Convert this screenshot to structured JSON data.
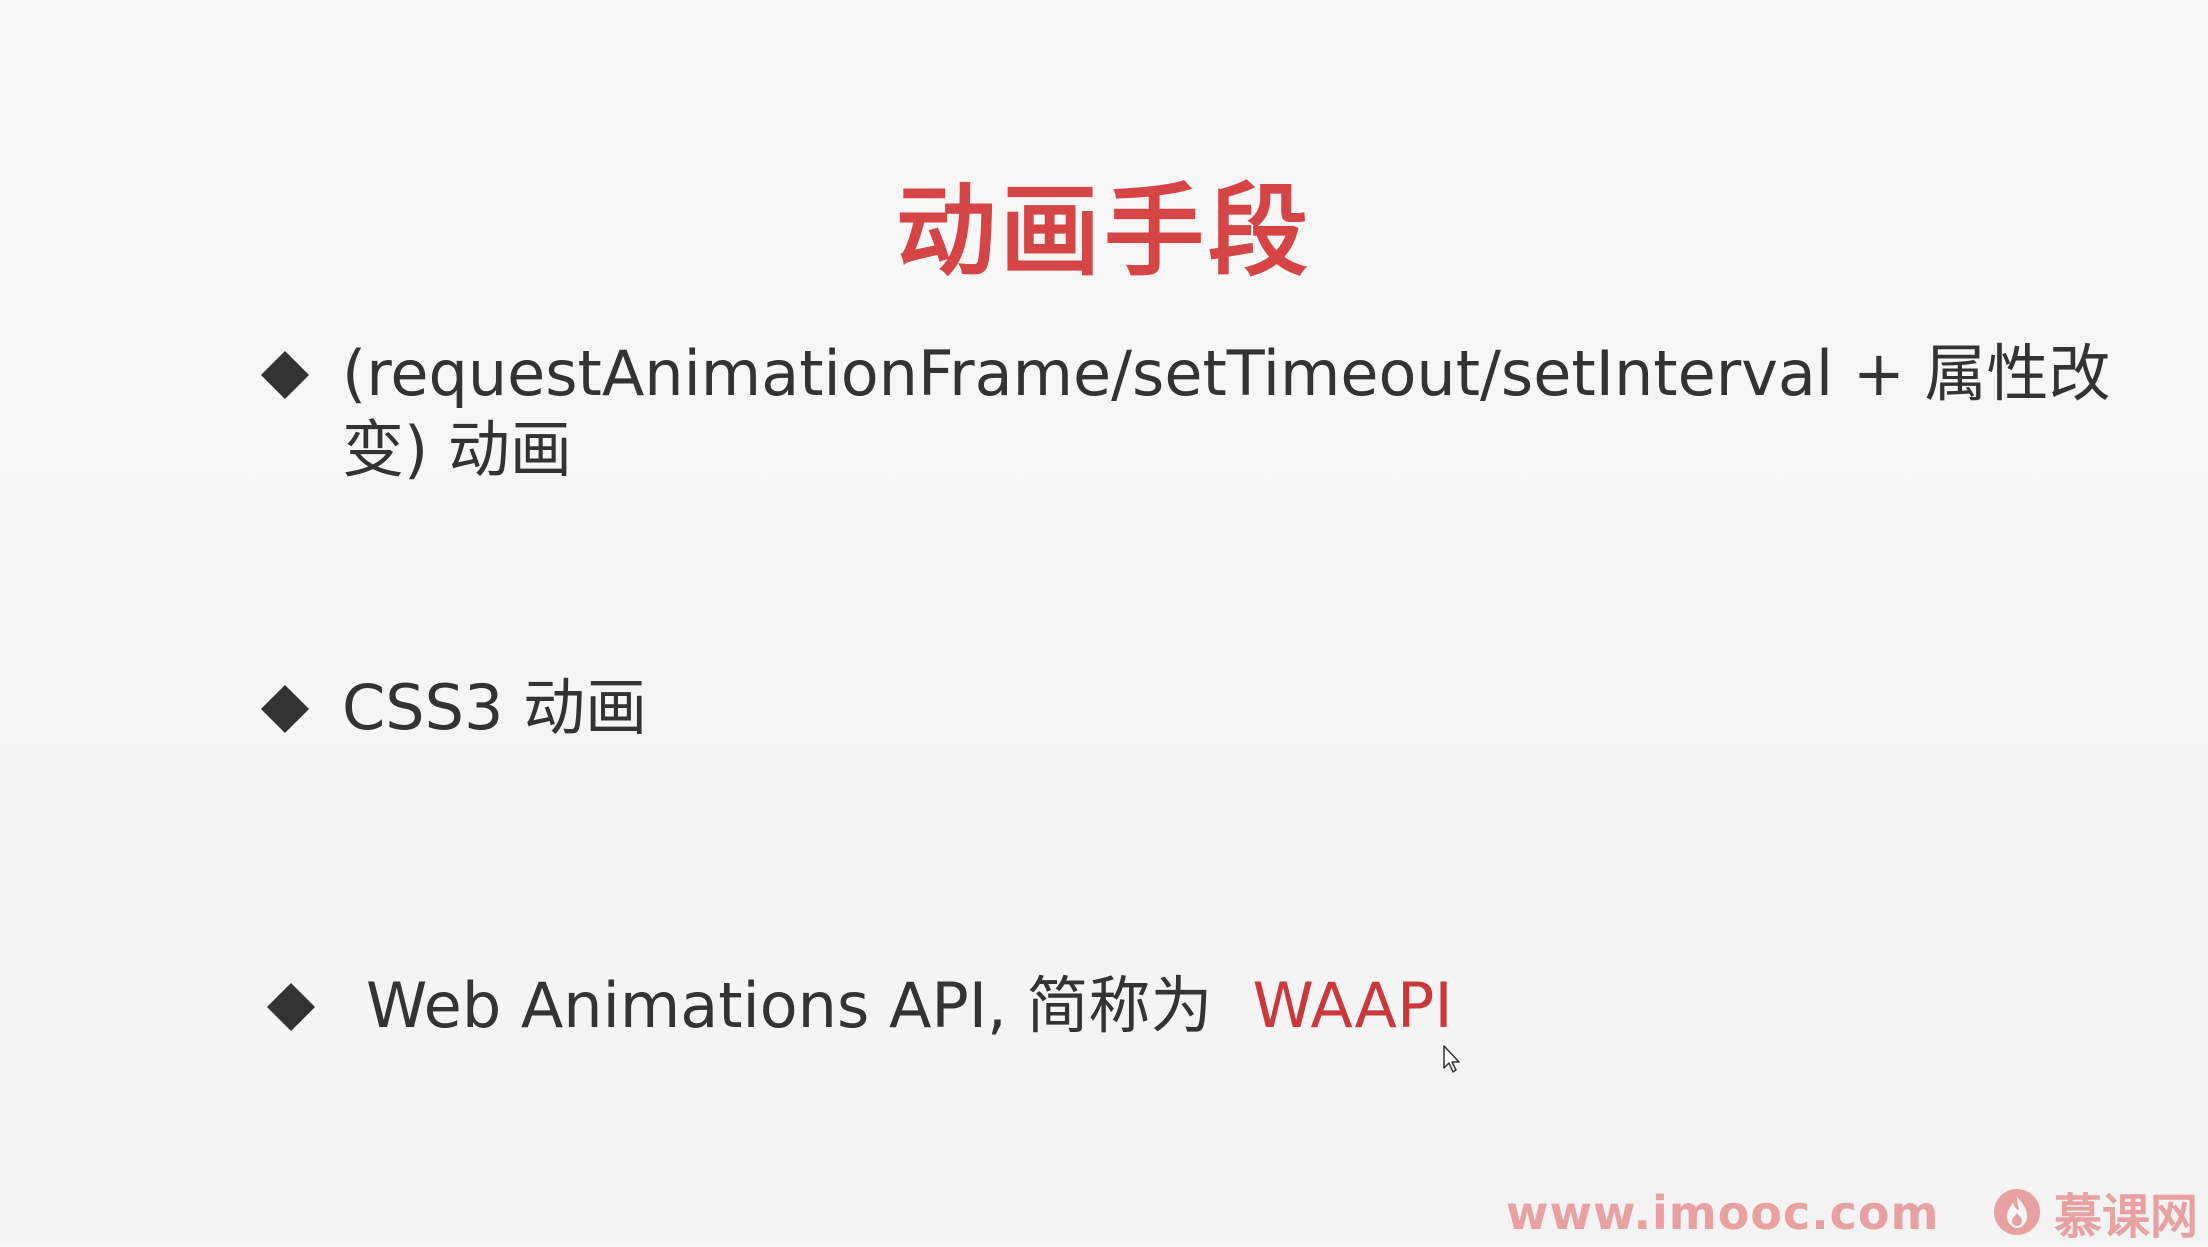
{
  "slide": {
    "title": "动画手段",
    "bullets": [
      {
        "text": "(requestAnimationFrame/setTimeout/setInterval + 属性改变) 动画"
      },
      {
        "text": "CSS3 动画"
      },
      {
        "text": "Web Animations API, 简称为",
        "accent": "WAAPI"
      }
    ]
  },
  "watermark": {
    "url": "www.imooc.com",
    "brand": "慕课网"
  },
  "colors": {
    "title": "#d54545",
    "text": "#333333",
    "accent": "#c9393b",
    "watermark": "#e7a1a1"
  },
  "icons": {
    "bullet": "diamond-bullet-icon",
    "cursor": "mouse-pointer-icon",
    "logo": "flame-logo-icon"
  }
}
